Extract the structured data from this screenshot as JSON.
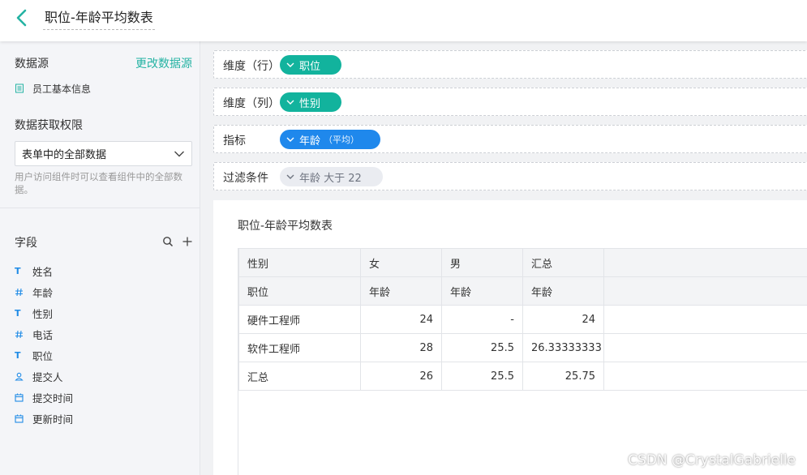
{
  "header": {
    "title": "职位-年龄平均数表"
  },
  "sidebar": {
    "datasource_title": "数据源",
    "change_datasource": "更改数据源",
    "datasource_item": "员工基本信息",
    "permission_title": "数据获取权限",
    "permission_select": "表单中的全部数据",
    "permission_hint": "用户访问组件时可以查看组件中的全部数据。",
    "fields_title": "字段",
    "fields": [
      {
        "label": "姓名",
        "icon": "text-type-icon"
      },
      {
        "label": "年龄",
        "icon": "number-type-icon"
      },
      {
        "label": "性别",
        "icon": "text-type-icon"
      },
      {
        "label": "电话",
        "icon": "number-type-icon"
      },
      {
        "label": "职位",
        "icon": "text-type-icon"
      },
      {
        "label": "提交人",
        "icon": "user-type-icon"
      },
      {
        "label": "提交时间",
        "icon": "date-type-icon"
      },
      {
        "label": "更新时间",
        "icon": "date-type-icon"
      }
    ]
  },
  "config": {
    "row_dim_label": "维度（行）",
    "row_dim_value": "职位",
    "col_dim_label": "维度（列）",
    "col_dim_value": "性别",
    "metric_label": "指标",
    "metric_value": "年龄",
    "metric_agg": "（平均）",
    "filter_label": "过滤条件",
    "filter_value": "年龄 大于 22"
  },
  "table": {
    "title": "职位-年龄平均数表",
    "header_row1": [
      "性别",
      "女",
      "男",
      "汇总"
    ],
    "header_row2": [
      "职位",
      "年龄",
      "年龄",
      "年龄"
    ],
    "rows": [
      [
        "硬件工程师",
        "24",
        "-",
        "24"
      ],
      [
        "软件工程师",
        "28",
        "25.5",
        "26.33333333"
      ],
      [
        "汇总",
        "26",
        "25.5",
        "25.75"
      ]
    ]
  },
  "watermark": "CSDN @CrystalGabrielle",
  "colors": {
    "teal": "#12b39d",
    "blue": "#1f88ec",
    "link": "#25b3a3"
  }
}
